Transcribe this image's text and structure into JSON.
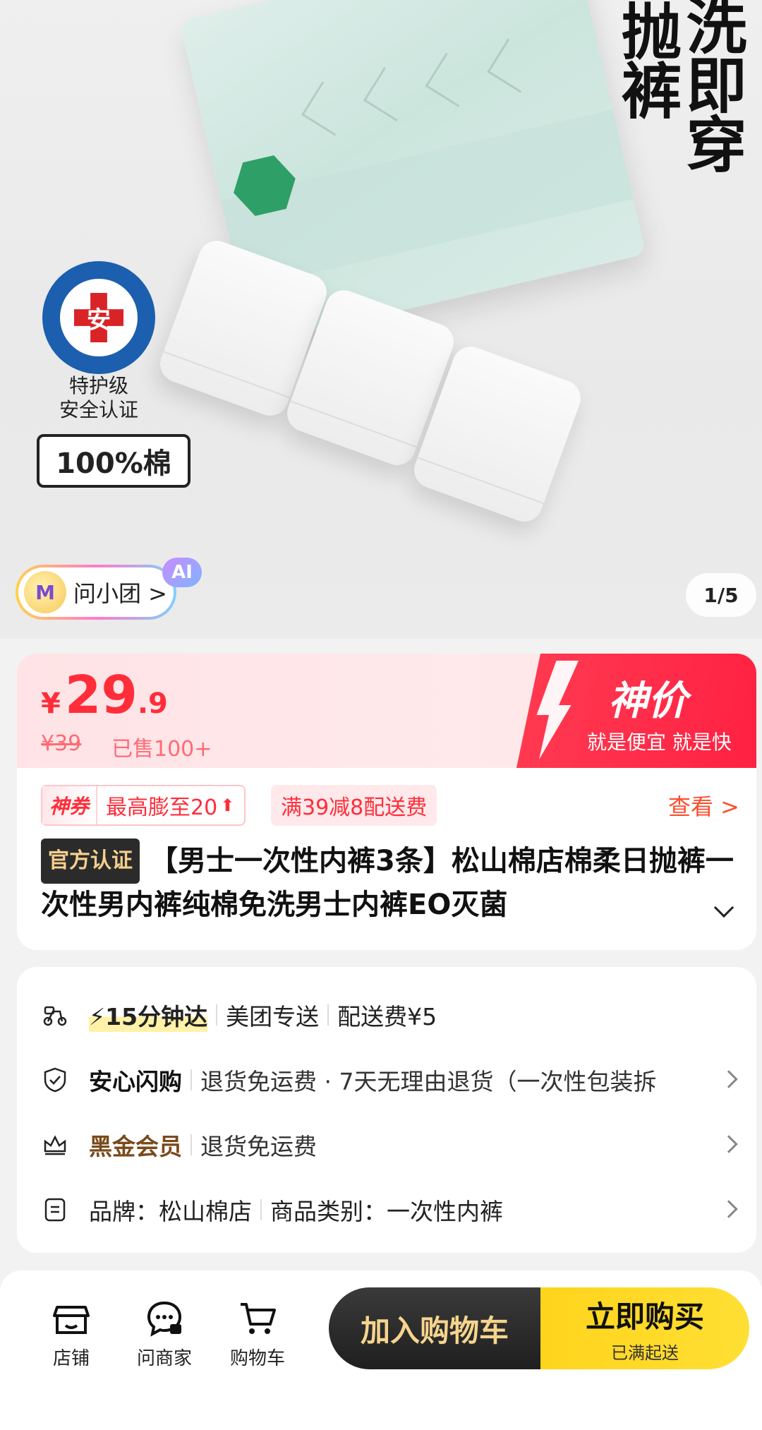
{
  "hero": {
    "slogan_col1": "洗即穿",
    "slogan_col2": "抛裤",
    "cert_symbol": "安",
    "cert_text": "特护级\n安全认证",
    "cotton_label": "100%棉",
    "ai_avatar_text": "M",
    "ai_label": "问小团 >",
    "ai_badge": "AI",
    "pager": "1/5"
  },
  "price": {
    "currency": "¥",
    "integer": "29",
    "decimal": ".9",
    "original": "¥39",
    "sold": "已售100+",
    "deal_title": "神价",
    "deal_subtitle": "就是便宜 就是快"
  },
  "coupons": {
    "tag": "神券",
    "max_expand": "最高膨至20",
    "delivery_discount": "满39减8配送费",
    "see_more": "查看 >"
  },
  "product": {
    "official_badge": "官方认证",
    "title": "【男士一次性内裤3条】松山棉店棉柔日抛裤一次性男内裤纯棉免洗男士内裤EO灭菌"
  },
  "info": {
    "delivery": {
      "speed": "15分钟达",
      "service": "美团专送",
      "fee": "配送费¥5"
    },
    "safe": {
      "name": "安心闪购",
      "detail": "退货免运费 · 7天无理由退货（一次性包装拆"
    },
    "vip": {
      "name": "黑金会员",
      "detail": "退货免运费"
    },
    "brand": {
      "brand_label": "品牌：松山棉店",
      "category_label": "商品类别：一次性内裤"
    }
  },
  "bottom": {
    "shop": "店铺",
    "ask": "问商家",
    "cart": "购物车",
    "add_cart": "加入购物车",
    "buy_now": "立即购买",
    "buy_sub": "已满起送"
  },
  "colors": {
    "accent_red": "#ff2d3a",
    "gold": "#f5d48d",
    "yellow": "#ffd41c"
  }
}
